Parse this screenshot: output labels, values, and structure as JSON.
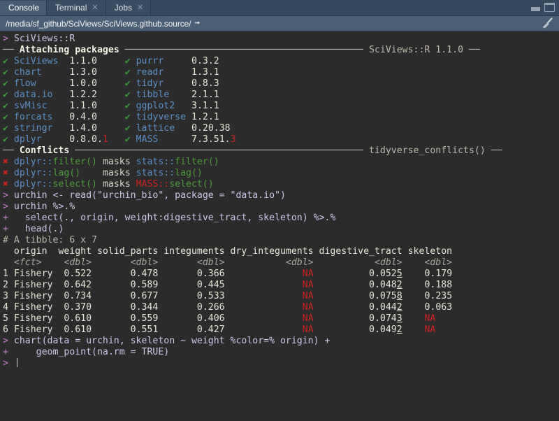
{
  "window": {
    "minimize_icon": "minimize-icon",
    "maximize_icon": "maximize-icon"
  },
  "tabs": [
    {
      "label": "Console",
      "active": true,
      "closable": false
    },
    {
      "label": "Terminal",
      "active": false,
      "closable": true
    },
    {
      "label": "Jobs",
      "active": false,
      "closable": true
    }
  ],
  "pathbar": {
    "path": "/media/sf_github/SciViews/SciViews.github.source/",
    "open_icon": "open-in-new-window-icon",
    "clear_icon": "broom-clear-console-icon"
  },
  "console": {
    "lines": [
      {
        "id": "cmd-sciviews",
        "segs": [
          {
            "t": "> ",
            "c": "prompt"
          },
          {
            "t": "SciViews::R",
            "c": "code"
          }
        ]
      },
      {
        "id": "rule-attaching",
        "segs": [
          {
            "t": "── ",
            "c": "rule"
          },
          {
            "t": "Attaching packages ",
            "c": "ruletitle"
          },
          {
            "t": "─────────────────────────────────────────── ",
            "c": "rule"
          },
          {
            "t": "SciViews::R 1.1.0 ──",
            "c": "rule"
          }
        ]
      },
      {
        "id": "pkg-row-1",
        "segs": [
          {
            "t": "✔ ",
            "c": "ok"
          },
          {
            "t": "SciViews  ",
            "c": "pkg"
          },
          {
            "t": "1.1.0     ",
            "c": "ver"
          },
          {
            "t": "✔ ",
            "c": "ok"
          },
          {
            "t": "purrr     ",
            "c": "pkg"
          },
          {
            "t": "0.3.2",
            "c": "ver"
          }
        ]
      },
      {
        "id": "pkg-row-2",
        "segs": [
          {
            "t": "✔ ",
            "c": "ok"
          },
          {
            "t": "chart     ",
            "c": "pkg"
          },
          {
            "t": "1.3.0     ",
            "c": "ver"
          },
          {
            "t": "✔ ",
            "c": "ok"
          },
          {
            "t": "readr     ",
            "c": "pkg"
          },
          {
            "t": "1.3.1",
            "c": "ver"
          }
        ]
      },
      {
        "id": "pkg-row-3",
        "segs": [
          {
            "t": "✔ ",
            "c": "ok"
          },
          {
            "t": "flow      ",
            "c": "pkg"
          },
          {
            "t": "1.0.0     ",
            "c": "ver"
          },
          {
            "t": "✔ ",
            "c": "ok"
          },
          {
            "t": "tidyr     ",
            "c": "pkg"
          },
          {
            "t": "0.8.3",
            "c": "ver"
          }
        ]
      },
      {
        "id": "pkg-row-4",
        "segs": [
          {
            "t": "✔ ",
            "c": "ok"
          },
          {
            "t": "data.io   ",
            "c": "pkg"
          },
          {
            "t": "1.2.2     ",
            "c": "ver"
          },
          {
            "t": "✔ ",
            "c": "ok"
          },
          {
            "t": "tibble    ",
            "c": "pkg"
          },
          {
            "t": "2.1.1",
            "c": "ver"
          }
        ]
      },
      {
        "id": "pkg-row-5",
        "segs": [
          {
            "t": "✔ ",
            "c": "ok"
          },
          {
            "t": "svMisc    ",
            "c": "pkg"
          },
          {
            "t": "1.1.0     ",
            "c": "ver"
          },
          {
            "t": "✔ ",
            "c": "ok"
          },
          {
            "t": "ggplot2   ",
            "c": "pkg"
          },
          {
            "t": "3.1.1",
            "c": "ver"
          }
        ]
      },
      {
        "id": "pkg-row-6",
        "segs": [
          {
            "t": "✔ ",
            "c": "ok"
          },
          {
            "t": "forcats   ",
            "c": "pkg"
          },
          {
            "t": "0.4.0     ",
            "c": "ver"
          },
          {
            "t": "✔ ",
            "c": "ok"
          },
          {
            "t": "tidyverse ",
            "c": "pkg"
          },
          {
            "t": "1.2.1",
            "c": "ver"
          }
        ]
      },
      {
        "id": "pkg-row-7",
        "segs": [
          {
            "t": "✔ ",
            "c": "ok"
          },
          {
            "t": "stringr   ",
            "c": "pkg"
          },
          {
            "t": "1.4.0     ",
            "c": "ver"
          },
          {
            "t": "✔ ",
            "c": "ok"
          },
          {
            "t": "lattice   ",
            "c": "pkg"
          },
          {
            "t": "0.20.38",
            "c": "ver"
          }
        ]
      },
      {
        "id": "pkg-row-8",
        "segs": [
          {
            "t": "✔ ",
            "c": "ok"
          },
          {
            "t": "dplyr     ",
            "c": "pkg"
          },
          {
            "t": "0.8.0.",
            "c": "ver"
          },
          {
            "t": "1",
            "c": "verbad"
          },
          {
            "t": "   ",
            "c": "ver"
          },
          {
            "t": "✔ ",
            "c": "ok"
          },
          {
            "t": "MASS      ",
            "c": "pkg"
          },
          {
            "t": "7.3.51.",
            "c": "ver"
          },
          {
            "t": "3",
            "c": "verbad"
          }
        ]
      },
      {
        "id": "rule-conflicts",
        "segs": [
          {
            "t": "── ",
            "c": "rule"
          },
          {
            "t": "Conflicts ",
            "c": "ruletitle"
          },
          {
            "t": "──────────────────────────────────────────────────── ",
            "c": "rule"
          },
          {
            "t": "tidyverse_conflicts() ──",
            "c": "rule"
          }
        ]
      },
      {
        "id": "conflict-filter",
        "segs": [
          {
            "t": "✖ ",
            "c": "bad"
          },
          {
            "t": "dplyr::",
            "c": "pkg"
          },
          {
            "t": "filter()",
            "c": "fn"
          },
          {
            "t": " masks ",
            "c": "plain"
          },
          {
            "t": "stats::",
            "c": "pkg"
          },
          {
            "t": "filter()",
            "c": "fn"
          }
        ]
      },
      {
        "id": "conflict-lag",
        "segs": [
          {
            "t": "✖ ",
            "c": "bad"
          },
          {
            "t": "dplyr::",
            "c": "pkg"
          },
          {
            "t": "lag()",
            "c": "fn"
          },
          {
            "t": "    masks ",
            "c": "plain"
          },
          {
            "t": "stats::",
            "c": "pkg"
          },
          {
            "t": "lag()",
            "c": "fn"
          }
        ]
      },
      {
        "id": "conflict-select",
        "segs": [
          {
            "t": "✖ ",
            "c": "bad"
          },
          {
            "t": "dplyr::",
            "c": "pkg"
          },
          {
            "t": "select()",
            "c": "fn"
          },
          {
            "t": " masks ",
            "c": "plain"
          },
          {
            "t": "MASS::",
            "c": "na"
          },
          {
            "t": "select()",
            "c": "fn"
          }
        ]
      },
      {
        "id": "cmd-read",
        "segs": [
          {
            "t": "> ",
            "c": "prompt"
          },
          {
            "t": "urchin <- read(\"urchin_bio\", package = \"data.io\")",
            "c": "code"
          }
        ]
      },
      {
        "id": "cmd-pipe-1",
        "segs": [
          {
            "t": "> ",
            "c": "prompt"
          },
          {
            "t": "urchin %>.%",
            "c": "code"
          }
        ]
      },
      {
        "id": "cmd-pipe-2",
        "segs": [
          {
            "t": "+ ",
            "c": "prompt"
          },
          {
            "t": "  select(., origin, weight:digestive_tract, skeleton) %>.%",
            "c": "code"
          }
        ]
      },
      {
        "id": "cmd-pipe-3",
        "segs": [
          {
            "t": "+ ",
            "c": "prompt"
          },
          {
            "t": "  head(.)",
            "c": "code"
          }
        ]
      },
      {
        "id": "tibble-caption",
        "segs": [
          {
            "t": "# A tibble: 6 x 7",
            "c": "cmt"
          }
        ]
      },
      {
        "id": "tibble-header",
        "segs": [
          {
            "t": "  origin  weight solid_parts integuments dry_integuments digestive_tract skeleton",
            "c": "hdr"
          }
        ]
      },
      {
        "id": "tibble-types",
        "segs": [
          {
            "t": "  <fct>    <dbl>       <dbl>       <dbl>           <dbl>           <dbl>    <dbl>",
            "c": "typ"
          }
        ]
      },
      {
        "id": "tibble-row-1",
        "segs": [
          {
            "t": "1 Fishery  0.522       0.478       0.366              ",
            "c": "num"
          },
          {
            "t": "NA",
            "c": "na"
          },
          {
            "t": "          0.052",
            "c": "num"
          },
          {
            "t": "5",
            "c": "num sig"
          },
          {
            "t": "    0.179",
            "c": "num"
          }
        ]
      },
      {
        "id": "tibble-row-2",
        "segs": [
          {
            "t": "2 Fishery  0.642       0.589       0.445              ",
            "c": "num"
          },
          {
            "t": "NA",
            "c": "na"
          },
          {
            "t": "          0.048",
            "c": "num"
          },
          {
            "t": "2",
            "c": "num sig"
          },
          {
            "t": "    0.188",
            "c": "num"
          }
        ]
      },
      {
        "id": "tibble-row-3",
        "segs": [
          {
            "t": "3 Fishery  0.734       0.677       0.533              ",
            "c": "num"
          },
          {
            "t": "NA",
            "c": "na"
          },
          {
            "t": "          0.075",
            "c": "num"
          },
          {
            "t": "8",
            "c": "num sig"
          },
          {
            "t": "    0.235",
            "c": "num"
          }
        ]
      },
      {
        "id": "tibble-row-4",
        "segs": [
          {
            "t": "4 Fishery  0.370       0.344       0.266              ",
            "c": "num"
          },
          {
            "t": "NA",
            "c": "na"
          },
          {
            "t": "          0.044",
            "c": "num"
          },
          {
            "t": "2",
            "c": "num sig"
          },
          {
            "t": "    0.063",
            "c": "num"
          }
        ]
      },
      {
        "id": "tibble-row-5",
        "segs": [
          {
            "t": "5 Fishery  0.610       0.559       0.406              ",
            "c": "num"
          },
          {
            "t": "NA",
            "c": "na"
          },
          {
            "t": "          0.074",
            "c": "num"
          },
          {
            "t": "3",
            "c": "num sig"
          },
          {
            "t": "    ",
            "c": "num"
          },
          {
            "t": "NA",
            "c": "na"
          }
        ]
      },
      {
        "id": "tibble-row-6",
        "segs": [
          {
            "t": "6 Fishery  0.610       0.551       0.427              ",
            "c": "num"
          },
          {
            "t": "NA",
            "c": "na"
          },
          {
            "t": "          0.049",
            "c": "num"
          },
          {
            "t": "2",
            "c": "num sig"
          },
          {
            "t": "    ",
            "c": "num"
          },
          {
            "t": "NA",
            "c": "na"
          }
        ]
      },
      {
        "id": "cmd-chart-1",
        "segs": [
          {
            "t": "> ",
            "c": "prompt"
          },
          {
            "t": "chart(data = urchin, skeleton ~ weight %color=% origin) +",
            "c": "code"
          }
        ]
      },
      {
        "id": "cmd-chart-2",
        "segs": [
          {
            "t": "+ ",
            "c": "prompt"
          },
          {
            "t": "    geom_point(na.rm = TRUE)",
            "c": "code"
          }
        ]
      }
    ],
    "final_prompt": "> ",
    "cursor": true
  },
  "colors": {
    "background": "#2b2b2b",
    "tabbar": "#36495c",
    "tab_active": "#475c70",
    "pathbar": "#4a5f73",
    "prompt": "#cb7bd1",
    "code": "#cfc7e8",
    "package": "#5d8fc7",
    "success": "#3f9e3f",
    "error": "#cc2222",
    "function": "#4e9a3a",
    "text": "#d6d6cc"
  },
  "tibble_table": {
    "caption": "# A tibble: 6 x 7",
    "columns": [
      "origin",
      "weight",
      "solid_parts",
      "integuments",
      "dry_integuments",
      "digestive_tract",
      "skeleton"
    ],
    "types": [
      "<fct>",
      "<dbl>",
      "<dbl>",
      "<dbl>",
      "<dbl>",
      "<dbl>",
      "<dbl>"
    ],
    "rows": [
      [
        "Fishery",
        "0.522",
        "0.478",
        "0.366",
        "NA",
        "0.0525",
        "0.179"
      ],
      [
        "Fishery",
        "0.642",
        "0.589",
        "0.445",
        "NA",
        "0.0482",
        "0.188"
      ],
      [
        "Fishery",
        "0.734",
        "0.677",
        "0.533",
        "NA",
        "0.0758",
        "0.235"
      ],
      [
        "Fishery",
        "0.370",
        "0.344",
        "0.266",
        "NA",
        "0.0442",
        "0.063"
      ],
      [
        "Fishery",
        "0.610",
        "0.559",
        "0.406",
        "NA",
        "0.0743",
        "NA"
      ],
      [
        "Fishery",
        "0.610",
        "0.551",
        "0.427",
        "NA",
        "0.0492",
        "NA"
      ]
    ]
  }
}
